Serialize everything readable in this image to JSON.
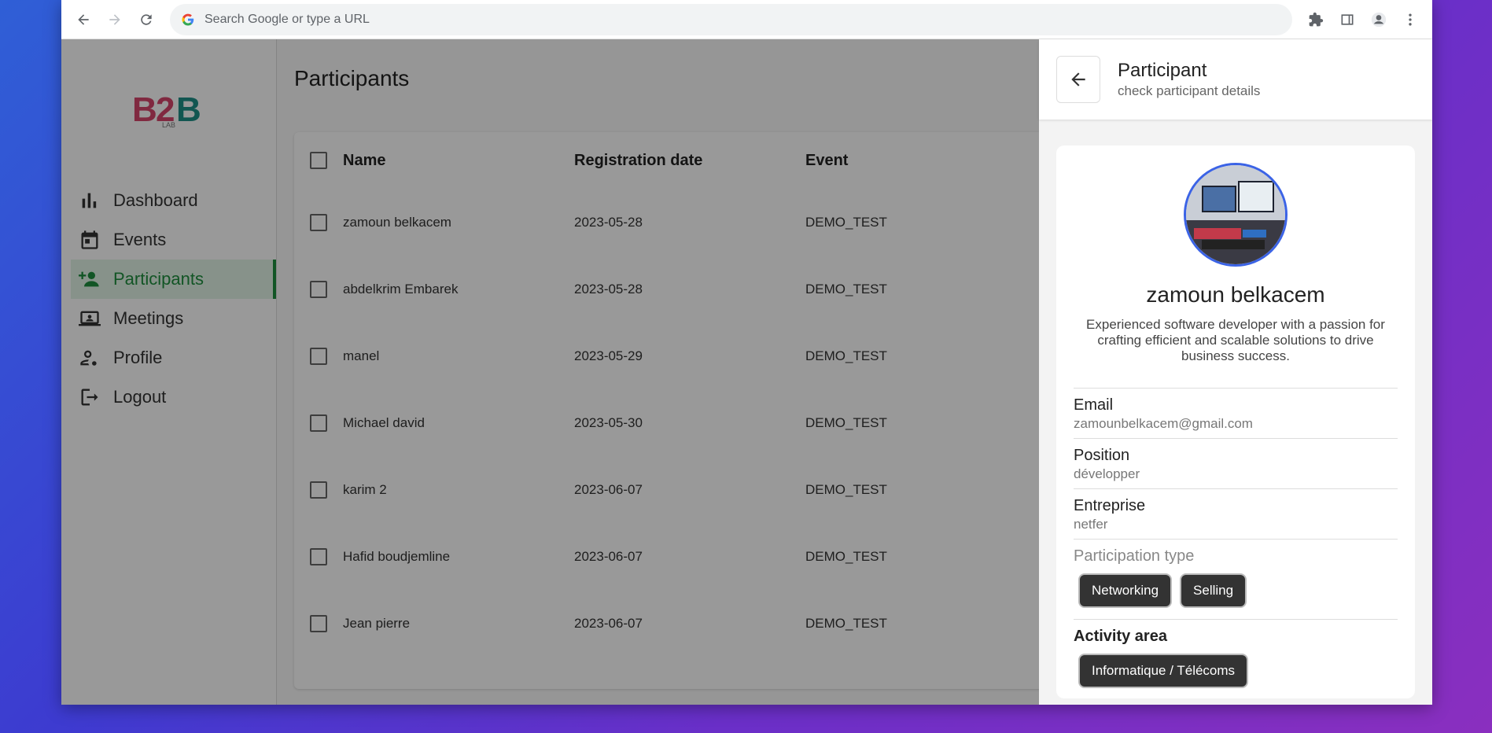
{
  "browser": {
    "omnibox_placeholder": "Search Google or type a URL"
  },
  "sidebar": {
    "logo_text": "B2B LAB",
    "items": [
      {
        "label": "Dashboard",
        "icon": "bar-chart-icon"
      },
      {
        "label": "Events",
        "icon": "calendar-icon"
      },
      {
        "label": "Participants",
        "icon": "people-add-icon",
        "active": true
      },
      {
        "label": "Meetings",
        "icon": "laptop-user-icon"
      },
      {
        "label": "Profile",
        "icon": "person-settings-icon"
      },
      {
        "label": "Logout",
        "icon": "logout-icon"
      }
    ]
  },
  "main": {
    "title": "Participants",
    "columns": [
      "Name",
      "Registration date",
      "Event"
    ],
    "rows": [
      {
        "name": "zamoun belkacem",
        "date": "2023-05-28",
        "event": "DEMO_TEST"
      },
      {
        "name": "abdelkrim Embarek",
        "date": "2023-05-28",
        "event": "DEMO_TEST"
      },
      {
        "name": "manel",
        "date": "2023-05-29",
        "event": "DEMO_TEST"
      },
      {
        "name": "Michael david",
        "date": "2023-05-30",
        "event": "DEMO_TEST"
      },
      {
        "name": "karim 2",
        "date": "2023-06-07",
        "event": "DEMO_TEST"
      },
      {
        "name": "Hafid boudjemline",
        "date": "2023-06-07",
        "event": "DEMO_TEST"
      },
      {
        "name": "Jean pierre",
        "date": "2023-06-07",
        "event": "DEMO_TEST"
      }
    ]
  },
  "drawer": {
    "title": "Participant",
    "subtitle": "check participant details",
    "name": "zamoun belkacem",
    "bio": "Experienced software developer with a passion for crafting efficient and scalable solutions to drive business success.",
    "email_label": "Email",
    "email": "zamounbelkacem@gmail.com",
    "position_label": "Position",
    "position": "développer",
    "company_label": "Entreprise",
    "company": "netfer",
    "participation_label": "Participation type",
    "participation": [
      "Networking",
      "Selling"
    ],
    "activity_label": "Activity area",
    "activity": [
      "Informatique / Télécoms"
    ]
  },
  "colors": {
    "accent": "#1e8e3e",
    "avatar_border": "#3b63e6",
    "chip_bg": "#333333"
  }
}
